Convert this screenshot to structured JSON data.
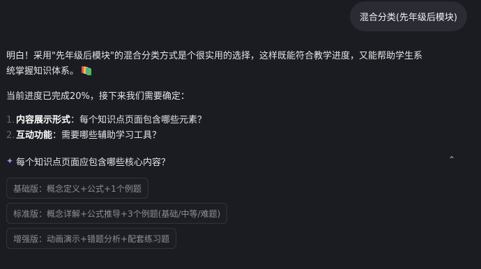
{
  "user_message": "混合分类(先年级后模块)",
  "reply": {
    "paragraph1": "明白！采用\"先年级后模块\"的混合分类方式是个很实用的选择，这样既能符合教学进度，又能帮助学生系统掌握知识体系。",
    "progress": "当前进度已完成20%，接下来我们需要确定：",
    "items": [
      {
        "num": "1.",
        "term": "内容展示形式",
        "text": "：每个知识点页面包含哪些元素？"
      },
      {
        "num": "2.",
        "term": "互动功能",
        "text": "：需要哪些辅助学习工具？"
      }
    ]
  },
  "question": {
    "icon": "sparkle-icon",
    "text": "每个知识点页面应包含哪些核心内容？",
    "collapse_icon": "chevron-up-icon"
  },
  "options": [
    "基础版：概念定义+公式+1个例题",
    "标准版：概念详解+公式推导+3个例题(基础/中等/难题)",
    "增强版：动画演示+错题分析+配套练习题"
  ],
  "colors": {
    "background": "#1b1c21",
    "bubble": "#2a2b33",
    "accent": "#a38cf3",
    "option_border": "#33343c"
  }
}
